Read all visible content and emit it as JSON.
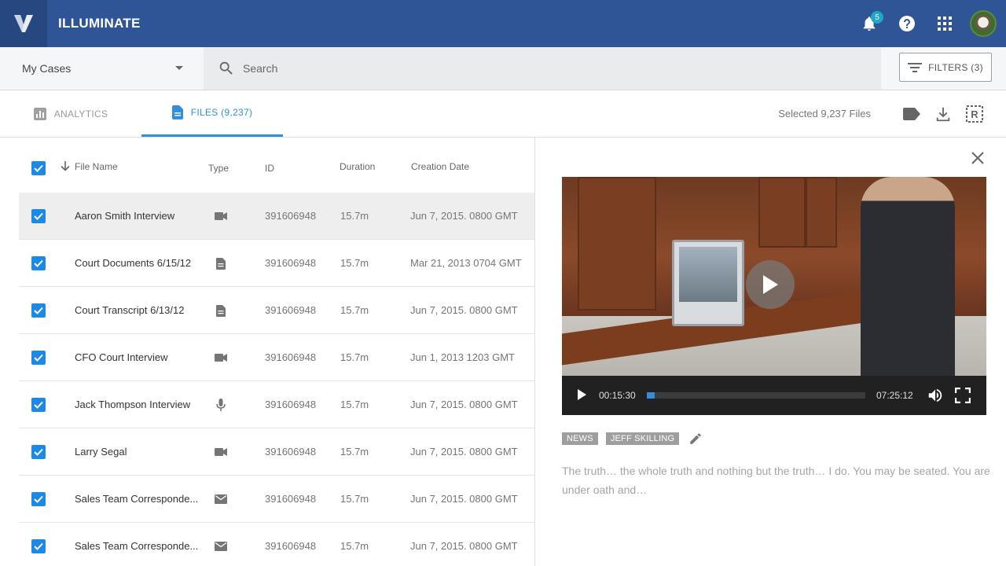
{
  "app": {
    "title": "ILLUMINATE",
    "notification_count": "5"
  },
  "search": {
    "case_selector_value": "My Cases",
    "placeholder": "Search",
    "filters_label": "FILTERS (3)"
  },
  "tabs": {
    "analytics_label": "ANALYTICS",
    "files_label": "FILES (9,237)",
    "selected_text": "Selected 9,237 Files"
  },
  "table": {
    "headers": {
      "file_name": "File Name",
      "type": "Type",
      "id": "ID",
      "duration": "Duration",
      "creation_date": "Creation Date"
    },
    "rows": [
      {
        "name": "Aaron Smith Interview",
        "type": "video-icon",
        "id": "391606948",
        "duration": "15.7m",
        "date": "Jun 7, 2015. 0800 GMT"
      },
      {
        "name": "Court Documents 6/15/12",
        "type": "document-icon",
        "id": "391606948",
        "duration": "15.7m",
        "date": "Mar 21, 2013  0704 GMT"
      },
      {
        "name": "Court Transcript 6/13/12",
        "type": "document-icon",
        "id": "391606948",
        "duration": "15.7m",
        "date": "Jun 7, 2015. 0800 GMT"
      },
      {
        "name": "CFO Court Interview",
        "type": "video-icon",
        "id": "391606948",
        "duration": "15.7m",
        "date": "Jun 1, 2013 1203 GMT"
      },
      {
        "name": "Jack Thompson Interview",
        "type": "microphone-icon",
        "id": "391606948",
        "duration": "15.7m",
        "date": "Jun 7, 2015. 0800 GMT"
      },
      {
        "name": "Larry Segal",
        "type": "video-icon",
        "id": "391606948",
        "duration": "15.7m",
        "date": "Jun 7, 2015. 0800 GMT"
      },
      {
        "name": "Sales Team Corresponde...",
        "type": "email-icon",
        "id": "391606948",
        "duration": "15.7m",
        "date": "Jun 7, 2015. 0800 GMT"
      },
      {
        "name": "Sales Team Corresponde...",
        "type": "email-icon",
        "id": "391606948",
        "duration": "15.7m",
        "date": "Jun 7, 2015. 0800 GMT"
      }
    ]
  },
  "player": {
    "current_time": "00:15:30",
    "total_time": "07:25:12",
    "progress_fraction": 0.035
  },
  "detail": {
    "tags": [
      "NEWS",
      "JEFF SKILLING"
    ],
    "transcript": "The truth… the whole truth and nothing but the truth… I do.  You may be seated. You are under oath and…"
  },
  "colors": {
    "appbar": "#2f5597",
    "accent": "#2f8fdd",
    "checkbox": "#1e88e5"
  }
}
